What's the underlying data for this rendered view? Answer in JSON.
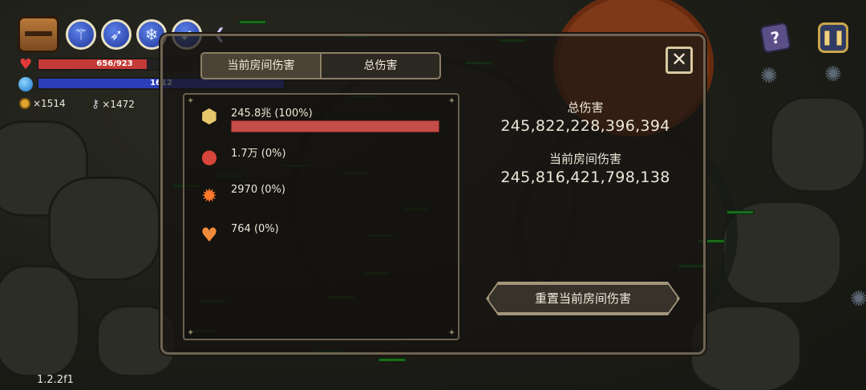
{
  "hud": {
    "hp": {
      "current": 656,
      "max": 923,
      "text": "656/923"
    },
    "mana": {
      "current": 1612,
      "max": 1612,
      "text": "1612"
    },
    "coins": "×1514",
    "keys": "×1472",
    "weapon_slots": [
      "staff-icon",
      "spear-icon",
      "ice-staff-icon",
      "rifle-icon"
    ],
    "version": "1.2.2f1"
  },
  "panel": {
    "tabs": [
      {
        "label": "当前房间伤害",
        "active": true
      },
      {
        "label": "总伤害",
        "active": false
      }
    ],
    "entries": [
      {
        "icon": "golden-crest-icon",
        "text": "245.8兆 (100%)",
        "share": 1.0
      },
      {
        "icon": "ladybug-orb-icon",
        "text": "1.7万 (0%)",
        "share": 0
      },
      {
        "icon": "fire-flower-icon",
        "text": "2970 (0%)",
        "share": 0
      },
      {
        "icon": "orange-heart-icon",
        "text": "764 (0%)",
        "share": 0
      }
    ],
    "total_label": "总伤害",
    "total_value": "245,822,228,396,394",
    "room_label": "当前房间伤害",
    "room_value": "245,816,421,798,138",
    "reset_label": "重置当前房间伤害",
    "close_label": "✕"
  },
  "colors": {
    "hp_fill": "#c43a36",
    "mana_fill": "#2c3fb8",
    "damage_bar": "#c64c48",
    "health_ticks": "#2fb734"
  }
}
